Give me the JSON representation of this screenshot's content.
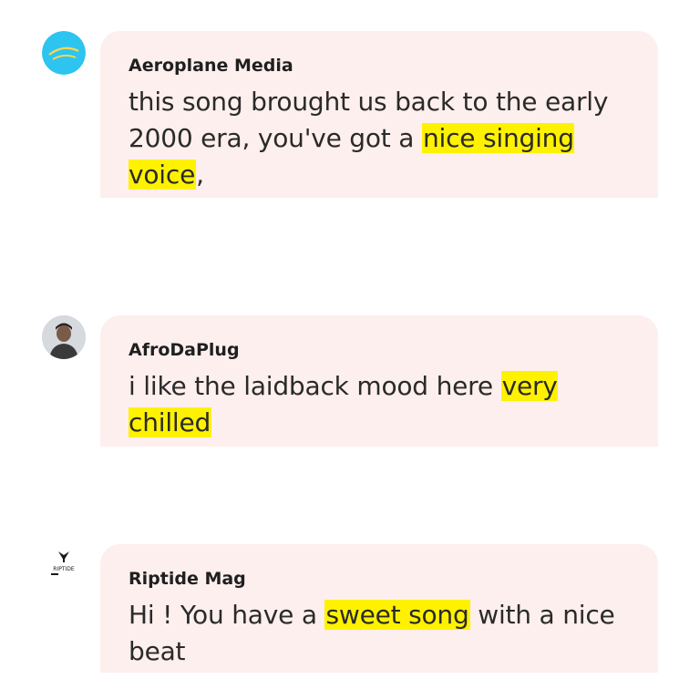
{
  "comments": [
    {
      "author": "Aeroplane Media",
      "avatar_icon": "aeroplane-media-logo",
      "text_before": "this song brought us back to the early 2000 era, you've got a ",
      "highlight": "nice singing voice",
      "text_after": ","
    },
    {
      "author": "AfroDaPlug",
      "avatar_icon": "user-photo",
      "text_before": "i like the laidback mood here ",
      "highlight": "very chilled",
      "text_after": ""
    },
    {
      "author": "Riptide Mag",
      "avatar_icon": "riptide-logo",
      "avatar_text": "RIPTIDE",
      "text_before": "Hi ! You have a ",
      "highlight": "sweet song",
      "text_after": " with a nice beat"
    }
  ],
  "colors": {
    "bubble": "#fdefed",
    "highlight": "#fff200",
    "aeroplane_avatar": "#2ec4f0"
  }
}
